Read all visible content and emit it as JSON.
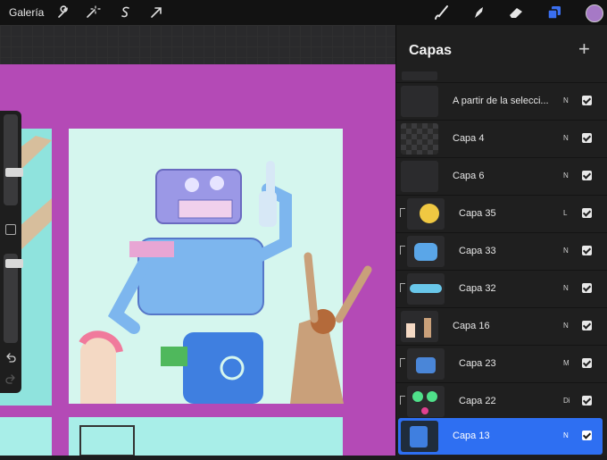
{
  "toolbar": {
    "gallery_label": "Galería",
    "tools_left": [
      "wrench-icon",
      "magic-wand-icon",
      "selection-s-icon",
      "transform-arrow-icon"
    ],
    "tools_right": [
      "brush-icon",
      "smudge-icon",
      "eraser-icon",
      "layers-icon",
      "color-swatch"
    ],
    "active_color": "#a679c6",
    "accent": "#3a6ff0"
  },
  "layers_panel": {
    "title": "Capas",
    "add_label": "+",
    "layers": [
      {
        "name": "A partir de la selecci...",
        "mode": "N",
        "visible": true,
        "clipped": false,
        "selected": false
      },
      {
        "name": "Capa 4",
        "mode": "N",
        "visible": true,
        "clipped": false,
        "selected": false
      },
      {
        "name": "Capa 6",
        "mode": "N",
        "visible": true,
        "clipped": false,
        "selected": false
      },
      {
        "name": "Capa 35",
        "mode": "L",
        "visible": true,
        "clipped": true,
        "selected": false
      },
      {
        "name": "Capa 33",
        "mode": "N",
        "visible": true,
        "clipped": true,
        "selected": false
      },
      {
        "name": "Capa 32",
        "mode": "N",
        "visible": true,
        "clipped": true,
        "selected": false
      },
      {
        "name": "Capa 16",
        "mode": "N",
        "visible": true,
        "clipped": false,
        "selected": false
      },
      {
        "name": "Capa 23",
        "mode": "M",
        "visible": true,
        "clipped": true,
        "selected": false
      },
      {
        "name": "Capa 22",
        "mode": "Di",
        "visible": true,
        "clipped": true,
        "selected": false
      },
      {
        "name": "Capa 13",
        "mode": "N",
        "visible": true,
        "clipped": false,
        "selected": true
      }
    ]
  },
  "canvas": {
    "background_color": "#b44ab6",
    "panel_color": "#c9f3ee"
  }
}
